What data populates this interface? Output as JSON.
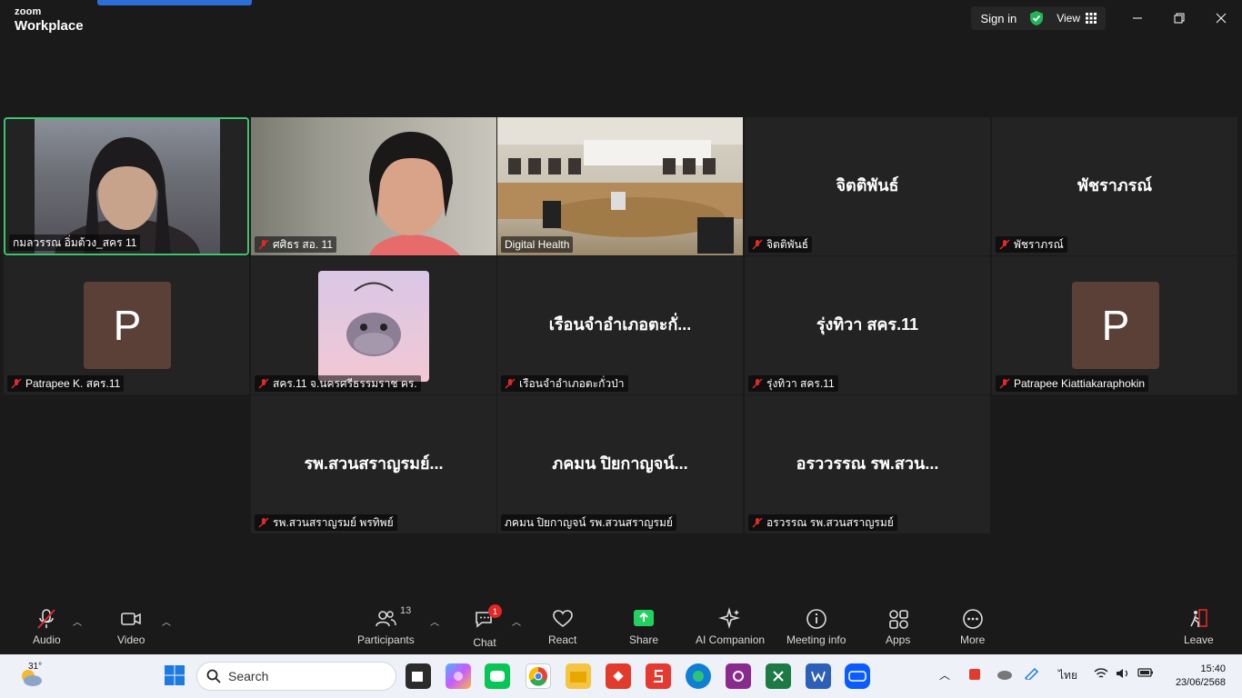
{
  "app": {
    "brand_top": "zoom",
    "brand_bottom": "Workplace"
  },
  "titlebar": {
    "sign_in": "Sign in",
    "view": "View"
  },
  "tiles": [
    {
      "name": "กมลวรรณ อิ่มต้วง_สคร 11",
      "type": "video"
    },
    {
      "name": "ศศิธร สอ. 11",
      "type": "video"
    },
    {
      "name": "Digital Health",
      "type": "video"
    },
    {
      "name": "จิตติพันธ์",
      "display": "จิตติพันธ์",
      "type": "name"
    },
    {
      "name": "พัชราภรณ์",
      "display": "พัชราภรณ์",
      "type": "name"
    },
    {
      "name": "Patrapee K. สคร.11",
      "avatar_letter": "P",
      "type": "avatar"
    },
    {
      "name": "สคร.11 จ.นครศรีธรรมราช คร.",
      "type": "picture"
    },
    {
      "name": "เรือนจำอำเภอตะกั่วป่า",
      "display": "เรือนจำอำเภอตะกั่...",
      "type": "name"
    },
    {
      "name": "รุ่งทิวา สคร.11",
      "display": "รุ่งทิวา สคร.11",
      "type": "name"
    },
    {
      "name": "Patrapee Kiattiakaraphokin",
      "avatar_letter": "P",
      "type": "avatar"
    },
    {
      "name": "รพ.สวนสราญรมย์ พรทิพย์",
      "display": "รพ.สวนสราญรมย์...",
      "type": "name"
    },
    {
      "name": "ภคมน ปิยกาญจน์ รพ.สวนสราญรมย์",
      "display": "ภคมน ปิยกาญจน์...",
      "type": "name"
    },
    {
      "name": "อรวรรณ รพ.สวนสราญรมย์",
      "display": "อรววรรณ รพ.สวน...",
      "type": "name"
    }
  ],
  "toolbar": {
    "audio": "Audio",
    "video": "Video",
    "participants": "Participants",
    "participants_count": "13",
    "chat": "Chat",
    "chat_badge": "1",
    "react": "React",
    "share": "Share",
    "ai": "AI Companion",
    "meeting_info": "Meeting info",
    "apps": "Apps",
    "more": "More",
    "leave": "Leave"
  },
  "taskbar": {
    "temperature": "31°",
    "search": "Search",
    "lang": "ไทย",
    "time": "15:40",
    "date": "23/06/2568"
  },
  "colors": {
    "accent_green": "#3ec46d",
    "share_green": "#23d160",
    "avatar_brown": "#5b4037",
    "muted_red": "#e02828"
  }
}
